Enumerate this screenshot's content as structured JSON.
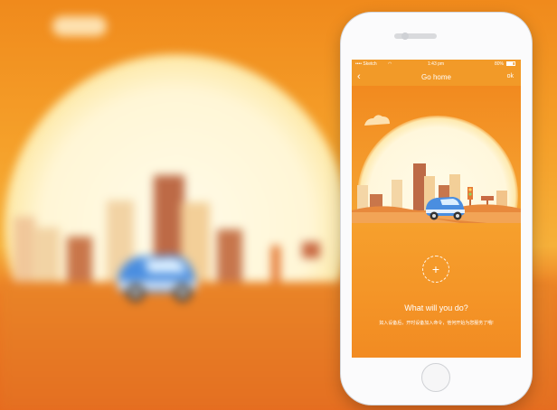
{
  "phone": {
    "statusbar": {
      "carrier": "•••• Sketch",
      "wifi_icon": "wifi-icon",
      "time": "1:43 pm",
      "battery": "80%",
      "battery_icon": "battery-icon"
    },
    "navbar": {
      "back_icon": "back-chevron-icon",
      "title": "Go home",
      "ok_label": "ok"
    },
    "prompt": {
      "add_icon": "plus-icon",
      "title": "What will you do?",
      "subtitle": "如入设备后，开时设备加入命令，他何开始为您服务了哦!"
    }
  },
  "colors": {
    "orange_dark": "#ec7a22",
    "orange_light": "#f6b03a",
    "sun": "#fff6d6",
    "car_blue": "#4a8ee0",
    "phone_body": "#fbfbfc"
  }
}
